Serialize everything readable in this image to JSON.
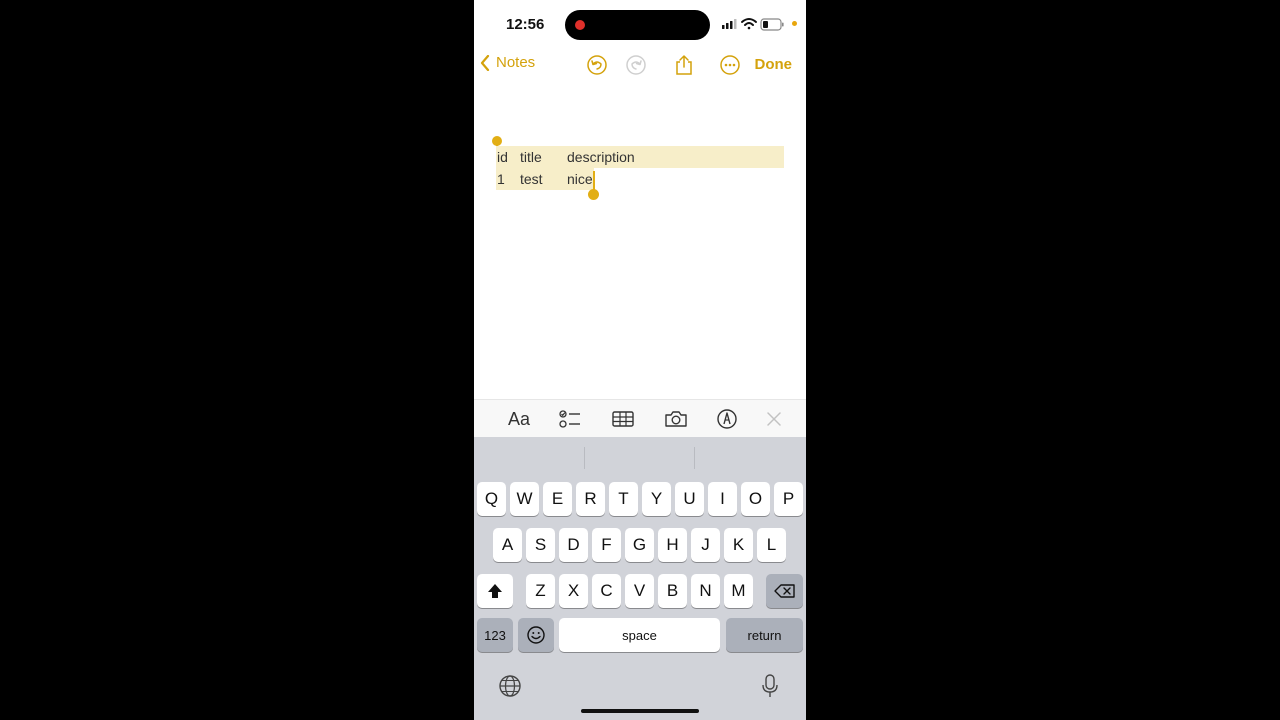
{
  "status_bar": {
    "time": "12:56"
  },
  "nav": {
    "back_label": "Notes",
    "done_label": "Done"
  },
  "note": {
    "rows": [
      [
        "id",
        "title",
        "description"
      ],
      [
        "1",
        "test",
        "nice"
      ]
    ]
  },
  "format_toolbar": {
    "text_style_label": "Aa"
  },
  "keyboard": {
    "row1": [
      "Q",
      "W",
      "E",
      "R",
      "T",
      "Y",
      "U",
      "I",
      "O",
      "P"
    ],
    "row2": [
      "A",
      "S",
      "D",
      "F",
      "G",
      "H",
      "J",
      "K",
      "L"
    ],
    "row3": [
      "Z",
      "X",
      "C",
      "V",
      "B",
      "N",
      "M"
    ],
    "numbers_label": "123",
    "space_label": "space",
    "return_label": "return"
  },
  "colors": {
    "accent": "#d4a20c",
    "selection": "#f7eec9",
    "handle": "#e2ae14",
    "keyboard_bg": "#d1d3d9"
  }
}
